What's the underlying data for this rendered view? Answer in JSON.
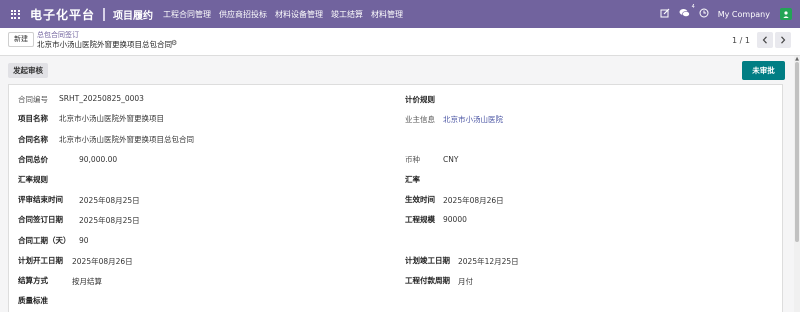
{
  "navbar": {
    "brand": "电子化平台",
    "app": "项目履约",
    "menus": [
      "工程合同管理",
      "供应商招投标",
      "材料设备管理",
      "竣工结算",
      "材料管理"
    ],
    "message_count": "4",
    "company": "My Company",
    "avatar_letter": "",
    "accent_color": "#71639e"
  },
  "control": {
    "new_label": "新建",
    "breadcrumb_parent": "总包合同签订",
    "breadcrumb_current": "北京市小汤山医院外窗更换项目总包合同",
    "pager": "1 / 1"
  },
  "status": {
    "submit_label": "发起审核",
    "stage_label": "未审批",
    "stage_color": "#017e84"
  },
  "form": {
    "contract_no_label": "合同编号",
    "contract_no": "SRHT_20250825_0003",
    "pricing_rule_label": "计价规则",
    "project_name_label": "项目名称",
    "project_name": "北京市小汤山医院外窗更换项目",
    "owner_label": "业主信息",
    "owner": "北京市小汤山医院",
    "contract_name_label": "合同名称",
    "contract_name": "北京市小汤山医院外窗更换项目总包合同",
    "total_price_label": "合同总价",
    "total_price": "90,000.00",
    "currency_label": "币种",
    "currency": "CNY",
    "exchange_rule_label": "汇率规则",
    "exchange_rate_label": "汇率",
    "review_end_label": "评审结束时间",
    "review_end": "2025年08月25日",
    "effective_label": "生效时间",
    "effective": "2025年08月26日",
    "sign_date_label": "合同签订日期",
    "sign_date": "2025年08月25日",
    "scale_label": "工程规模",
    "scale": "90000",
    "duration_label": "合同工期（天）",
    "duration": "90",
    "plan_start_label": "计划开工日期",
    "plan_start": "2025年08月26日",
    "plan_end_label": "计划竣工日期",
    "plan_end": "2025年12月25日",
    "settlement_label": "结算方式",
    "settlement": "按月结算",
    "payment_cycle_label": "工程付款周期",
    "payment_cycle": "月付",
    "quality_label": "质量标准"
  }
}
